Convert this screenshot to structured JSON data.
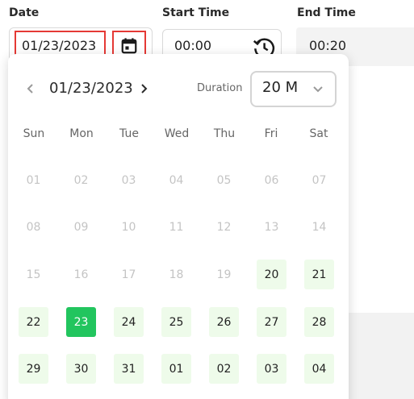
{
  "labels": {
    "date": "Date",
    "start_time": "Start Time",
    "end_time": "End Time"
  },
  "date_field": {
    "value": "01/23/2023"
  },
  "start_time_field": {
    "value": "00:00"
  },
  "end_time_field": {
    "value": "00:20"
  },
  "calendar": {
    "month_label": "01/23/2023",
    "duration_label": "Duration",
    "duration_value": "20 M",
    "weekdays": [
      "Sun",
      "Mon",
      "Tue",
      "Wed",
      "Thu",
      "Fri",
      "Sat"
    ],
    "weeks": [
      [
        {
          "d": "01",
          "s": "off"
        },
        {
          "d": "02",
          "s": "off"
        },
        {
          "d": "03",
          "s": "off"
        },
        {
          "d": "04",
          "s": "off"
        },
        {
          "d": "05",
          "s": "off"
        },
        {
          "d": "06",
          "s": "off"
        },
        {
          "d": "07",
          "s": "off"
        }
      ],
      [
        {
          "d": "08",
          "s": "off"
        },
        {
          "d": "09",
          "s": "off"
        },
        {
          "d": "10",
          "s": "off"
        },
        {
          "d": "11",
          "s": "off"
        },
        {
          "d": "12",
          "s": "off"
        },
        {
          "d": "13",
          "s": "off"
        },
        {
          "d": "14",
          "s": "off"
        }
      ],
      [
        {
          "d": "15",
          "s": "off"
        },
        {
          "d": "16",
          "s": "off"
        },
        {
          "d": "17",
          "s": "off"
        },
        {
          "d": "18",
          "s": "off"
        },
        {
          "d": "19",
          "s": "off"
        },
        {
          "d": "20",
          "s": "on"
        },
        {
          "d": "21",
          "s": "on"
        }
      ],
      [
        {
          "d": "22",
          "s": "on"
        },
        {
          "d": "23",
          "s": "sel"
        },
        {
          "d": "24",
          "s": "on"
        },
        {
          "d": "25",
          "s": "on"
        },
        {
          "d": "26",
          "s": "on"
        },
        {
          "d": "27",
          "s": "on"
        },
        {
          "d": "28",
          "s": "on"
        }
      ],
      [
        {
          "d": "29",
          "s": "on"
        },
        {
          "d": "30",
          "s": "on"
        },
        {
          "d": "31",
          "s": "on"
        },
        {
          "d": "01",
          "s": "on"
        },
        {
          "d": "02",
          "s": "on"
        },
        {
          "d": "03",
          "s": "on"
        },
        {
          "d": "04",
          "s": "on"
        }
      ]
    ]
  },
  "icons": {
    "calendar": "calendar-icon",
    "clock": "history-clock-icon",
    "prev": "chevron-left-icon",
    "next": "chevron-right-icon",
    "dropdown": "chevron-down-icon"
  },
  "colors": {
    "highlight_border": "#e53935",
    "selected_day": "#22c55e",
    "available_day": "#eefbea",
    "disabled_day_text": "#c4c4c4"
  }
}
